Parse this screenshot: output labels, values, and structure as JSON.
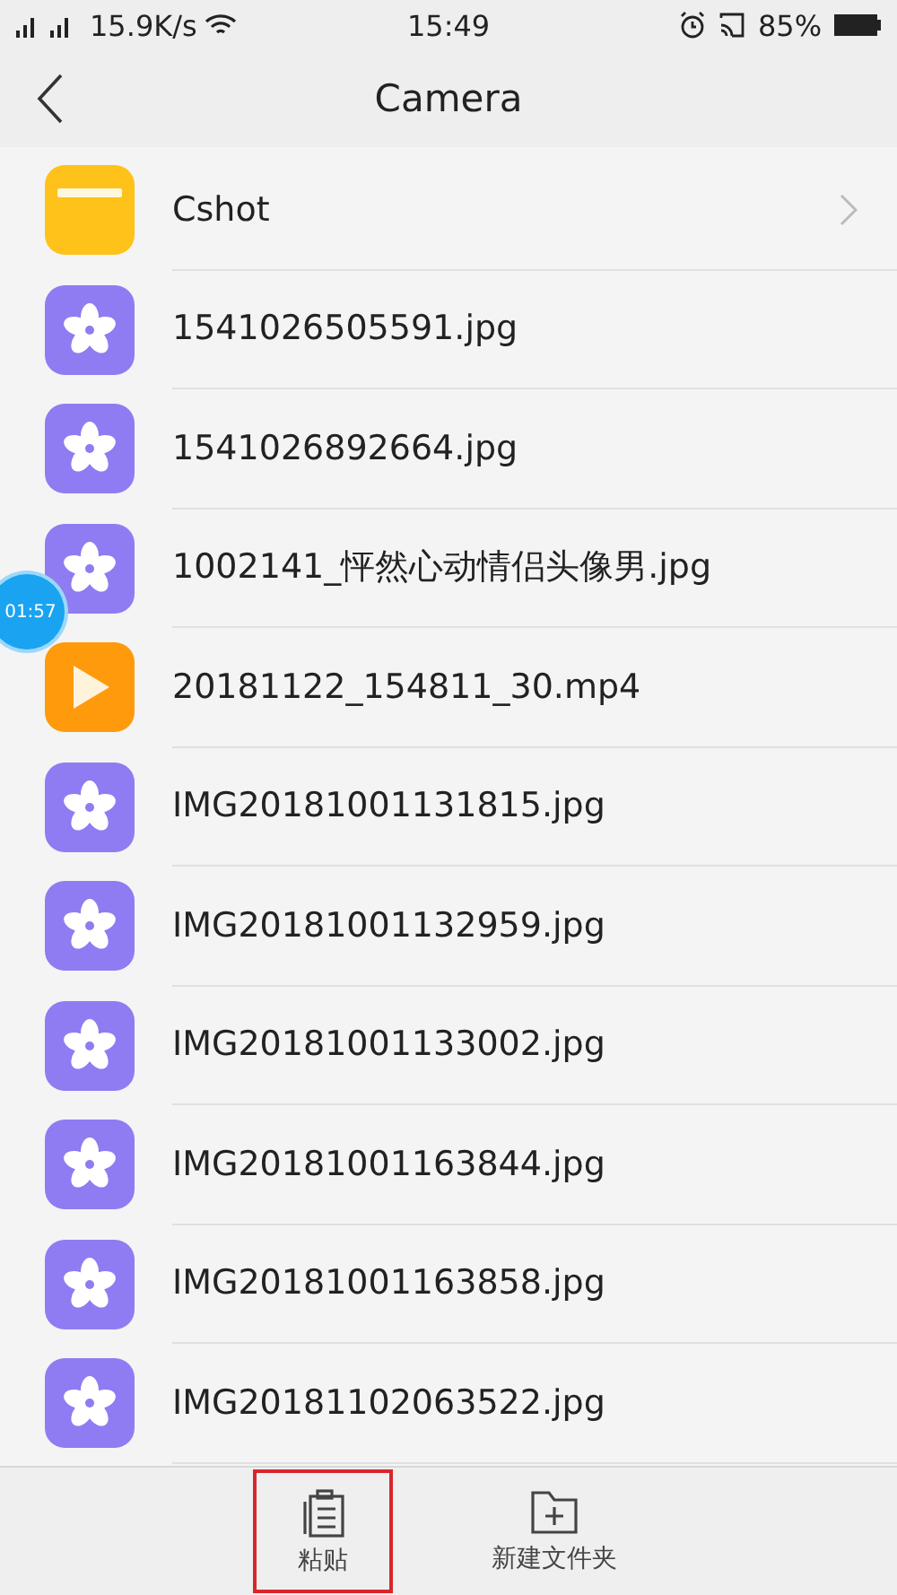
{
  "status_bar": {
    "network": "15.9K/s",
    "time": "15:49",
    "battery": "85%"
  },
  "header": {
    "title": "Camera"
  },
  "files": [
    {
      "kind": "folder",
      "name": "Cshot"
    },
    {
      "kind": "image",
      "name": "1541026505591.jpg"
    },
    {
      "kind": "image",
      "name": "1541026892664.jpg"
    },
    {
      "kind": "image",
      "name": "1002141_怦然心动情侣头像男.jpg"
    },
    {
      "kind": "video",
      "name": "20181122_154811_30.mp4"
    },
    {
      "kind": "image",
      "name": "IMG20181001131815.jpg"
    },
    {
      "kind": "image",
      "name": "IMG20181001132959.jpg"
    },
    {
      "kind": "image",
      "name": "IMG20181001133002.jpg"
    },
    {
      "kind": "image",
      "name": "IMG20181001163844.jpg"
    },
    {
      "kind": "image",
      "name": "IMG20181001163858.jpg"
    },
    {
      "kind": "image",
      "name": "IMG20181102063522.jpg"
    }
  ],
  "floating_timer": "01:57",
  "bottom_bar": [
    {
      "kind": "paste",
      "label": "粘贴",
      "highlighted": true
    },
    {
      "kind": "new-folder",
      "label": "新建文件夹",
      "highlighted": false
    }
  ]
}
